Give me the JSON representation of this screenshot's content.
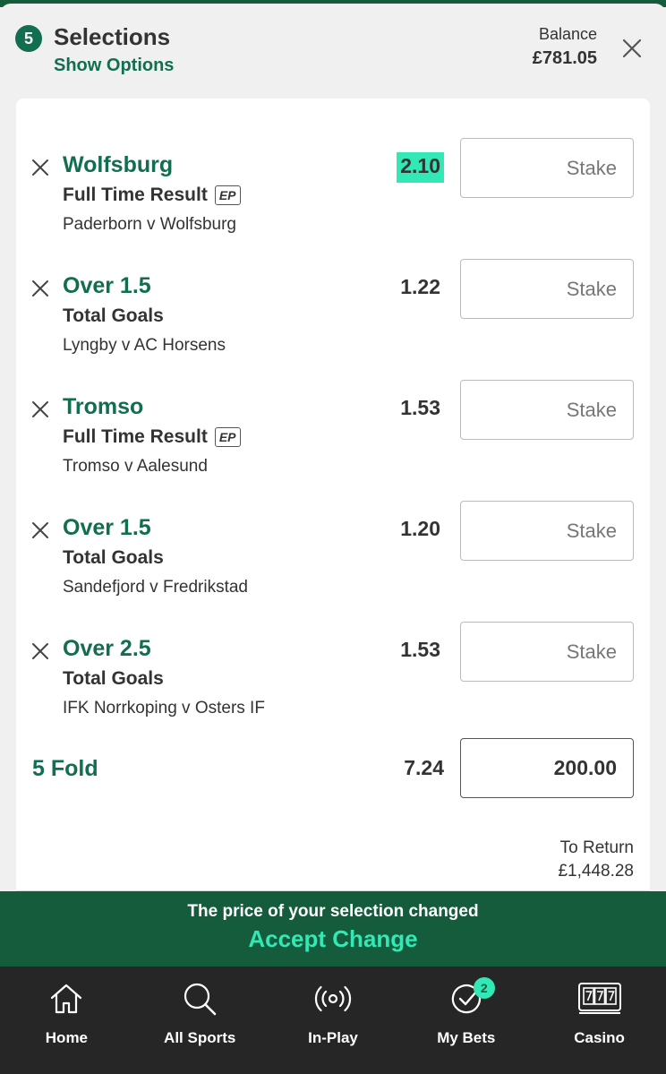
{
  "header": {
    "count": "5",
    "title": "Selections",
    "show_options": "Show Options",
    "balance_label": "Balance",
    "balance_value": "£781.05"
  },
  "selections": [
    {
      "name": "Wolfsburg",
      "market": "Full Time Result",
      "ep": "EP",
      "event": "Paderborn v Wolfsburg",
      "odds": "2.10",
      "stake_placeholder": "Stake",
      "odds_changed": true
    },
    {
      "name": "Over 1.5",
      "market": "Total Goals",
      "ep": "",
      "event": "Lyngby v AC Horsens",
      "odds": "1.22",
      "stake_placeholder": "Stake",
      "odds_changed": false
    },
    {
      "name": "Tromso",
      "market": "Full Time Result",
      "ep": "EP",
      "event": "Tromso v Aalesund",
      "odds": "1.53",
      "stake_placeholder": "Stake",
      "odds_changed": false
    },
    {
      "name": "Over 1.5",
      "market": "Total Goals",
      "ep": "",
      "event": "Sandefjord v Fredrikstad",
      "odds": "1.20",
      "stake_placeholder": "Stake",
      "odds_changed": false
    },
    {
      "name": "Over 2.5",
      "market": "Total Goals",
      "ep": "",
      "event": "IFK Norrkoping v Osters IF",
      "odds": "1.53",
      "stake_placeholder": "Stake",
      "odds_changed": false
    }
  ],
  "fold": {
    "label": "5 Fold",
    "odds": "7.24",
    "stake": "200.00"
  },
  "returns": {
    "label": "To Return",
    "value": "£1,448.28"
  },
  "banner": {
    "message": "The price of your selection changed",
    "action": "Accept Change"
  },
  "nav": {
    "items": [
      {
        "label": "Home",
        "icon": "home-icon"
      },
      {
        "label": "All Sports",
        "icon": "search-icon"
      },
      {
        "label": "In-Play",
        "icon": "broadcast-icon"
      },
      {
        "label": "My Bets",
        "icon": "check-circle-icon",
        "badge": "2"
      },
      {
        "label": "Casino",
        "icon": "slot-machine-icon"
      }
    ]
  },
  "colors": {
    "brand_green": "#126e51",
    "dark_green": "#145c3c",
    "accent_mint": "#32e8b4",
    "nav_bg": "#262626"
  }
}
